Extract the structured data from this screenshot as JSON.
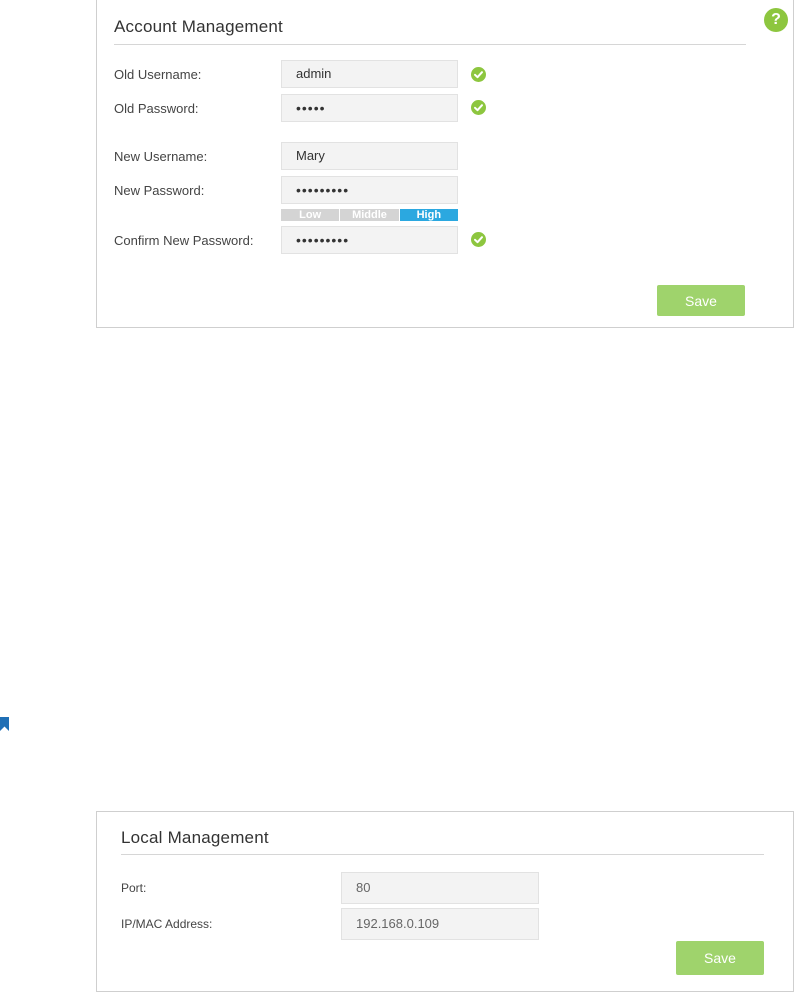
{
  "account": {
    "title": "Account Management",
    "old_username_label": "Old Username:",
    "old_username_value": "admin",
    "old_password_label": "Old Password:",
    "old_password_value": "•••••",
    "new_username_label": "New Username:",
    "new_username_value": "Mary",
    "new_password_label": "New Password:",
    "new_password_value": "•••••••••",
    "strength": {
      "low": "Low",
      "middle": "Middle",
      "high": "High",
      "level": "high"
    },
    "confirm_password_label": "Confirm New Password:",
    "confirm_password_value": "•••••••••",
    "save_label": "Save",
    "help_label": "?"
  },
  "local": {
    "title": "Local Management",
    "port_label": "Port:",
    "port_value": "80",
    "ip_label": "IP/MAC Address:",
    "ip_value": "192.168.0.109",
    "save_label": "Save"
  },
  "colors": {
    "accent_green": "#8dc63f",
    "button_green": "#9fd36c",
    "strength_high": "#2ba8e0"
  }
}
